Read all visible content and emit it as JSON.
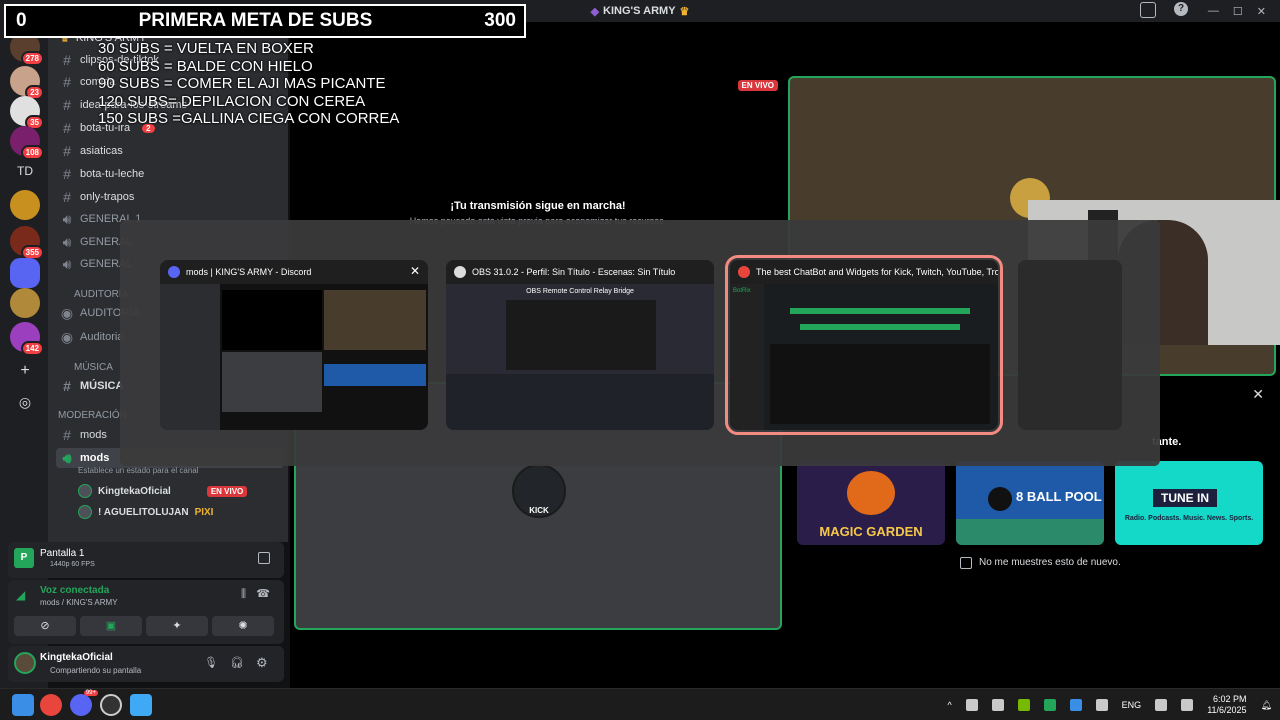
{
  "window": {
    "title": "KING'S ARMY"
  },
  "subs_goal": {
    "current": "0",
    "title": "PRIMERA META DE SUBS",
    "target": "300",
    "goals": [
      "30 SUBS = VUELTA EN BOXER",
      "60 SUBS = BALDE CON HIELO",
      "90 SUBS = COMER EL AJI MAS PICANTE",
      "120 SUBS= DEPILACION CON CEREA",
      "150 SUBS =GALLINA CIEGA CON CORREA"
    ]
  },
  "rail": {
    "badges": [
      "278",
      "23",
      "35",
      "108",
      "355",
      "142"
    ],
    "td_label": "TD"
  },
  "sidebar": {
    "server_name": "KING'S ARMY",
    "channels": [
      {
        "name": "clipsos-de-tiktok"
      },
      {
        "name": "comida"
      },
      {
        "name": "idea-para-los-streams"
      },
      {
        "name": "bota-tu-ira",
        "badge": "2"
      },
      {
        "name": "asiaticas"
      },
      {
        "name": "bota-tu-leche"
      },
      {
        "name": "only-trapos"
      }
    ],
    "voice_channels": [
      "GENERAL 1",
      "GENERAL",
      "GENERAL"
    ],
    "category_auditoria": "AUDITORÍA",
    "auditoria_items": [
      "AUDITORÍA",
      "Auditoria"
    ],
    "category_musica": "MÚSICA",
    "musica_item": "MÚSICA",
    "category_moderacion": "MODERACIÓN",
    "mods_text": "mods",
    "mods_voice": "mods",
    "status_hint": "Establece un estado para el canal",
    "voice_users": [
      {
        "name": "KingtekaOficial",
        "live": "EN VIVO"
      },
      {
        "name": "! AGUELITOLUJAN",
        "tag": "PIXI"
      }
    ]
  },
  "screen_panel": {
    "title": "Pantalla 1",
    "quality": "1440p 60 FPS"
  },
  "voice_panel": {
    "status": "Voz conectada",
    "location": "mods / KING'S ARMY"
  },
  "user_panel": {
    "name": "KingtekaOficial",
    "status": "Compartiendo su pantalla"
  },
  "stage": {
    "live_badge": "EN VIVO",
    "stream_msg": "¡Tu transmisión sigue en marcha!",
    "stream_sub": "Hemos pausado esta vista previa para economizar tus recursos.",
    "activity_suffix": "tante.",
    "kick_label": "KICK",
    "promo": [
      "MAGIC GARDEN",
      "8 BALL POOL",
      "TUNE IN"
    ],
    "promo_tagline": "Radio. Podcasts. Music. News. Sports.",
    "dont_show": "No me muestres esto de nuevo."
  },
  "switcher": {
    "cards": [
      {
        "title": "mods | KING'S ARMY - Discord"
      },
      {
        "title": "OBS 31.0.2 - Perfil: Sin Título - Escenas: Sin Título",
        "inner_title": "OBS Remote Control Relay Bridge"
      },
      {
        "title": "The best ChatBot and Widgets for Kick, Twitch, YouTube, Trovo a...",
        "inner_title": "BotRix"
      }
    ]
  },
  "taskbar": {
    "lang": "ENG",
    "time": "6:02 PM",
    "date": "11/6/2025",
    "discord_badge": "99+"
  },
  "colors": {
    "discord_bg": "#2b2d31",
    "accent_green": "#23a55a",
    "live_red": "#da373c",
    "active_outline": "#f28b82"
  }
}
